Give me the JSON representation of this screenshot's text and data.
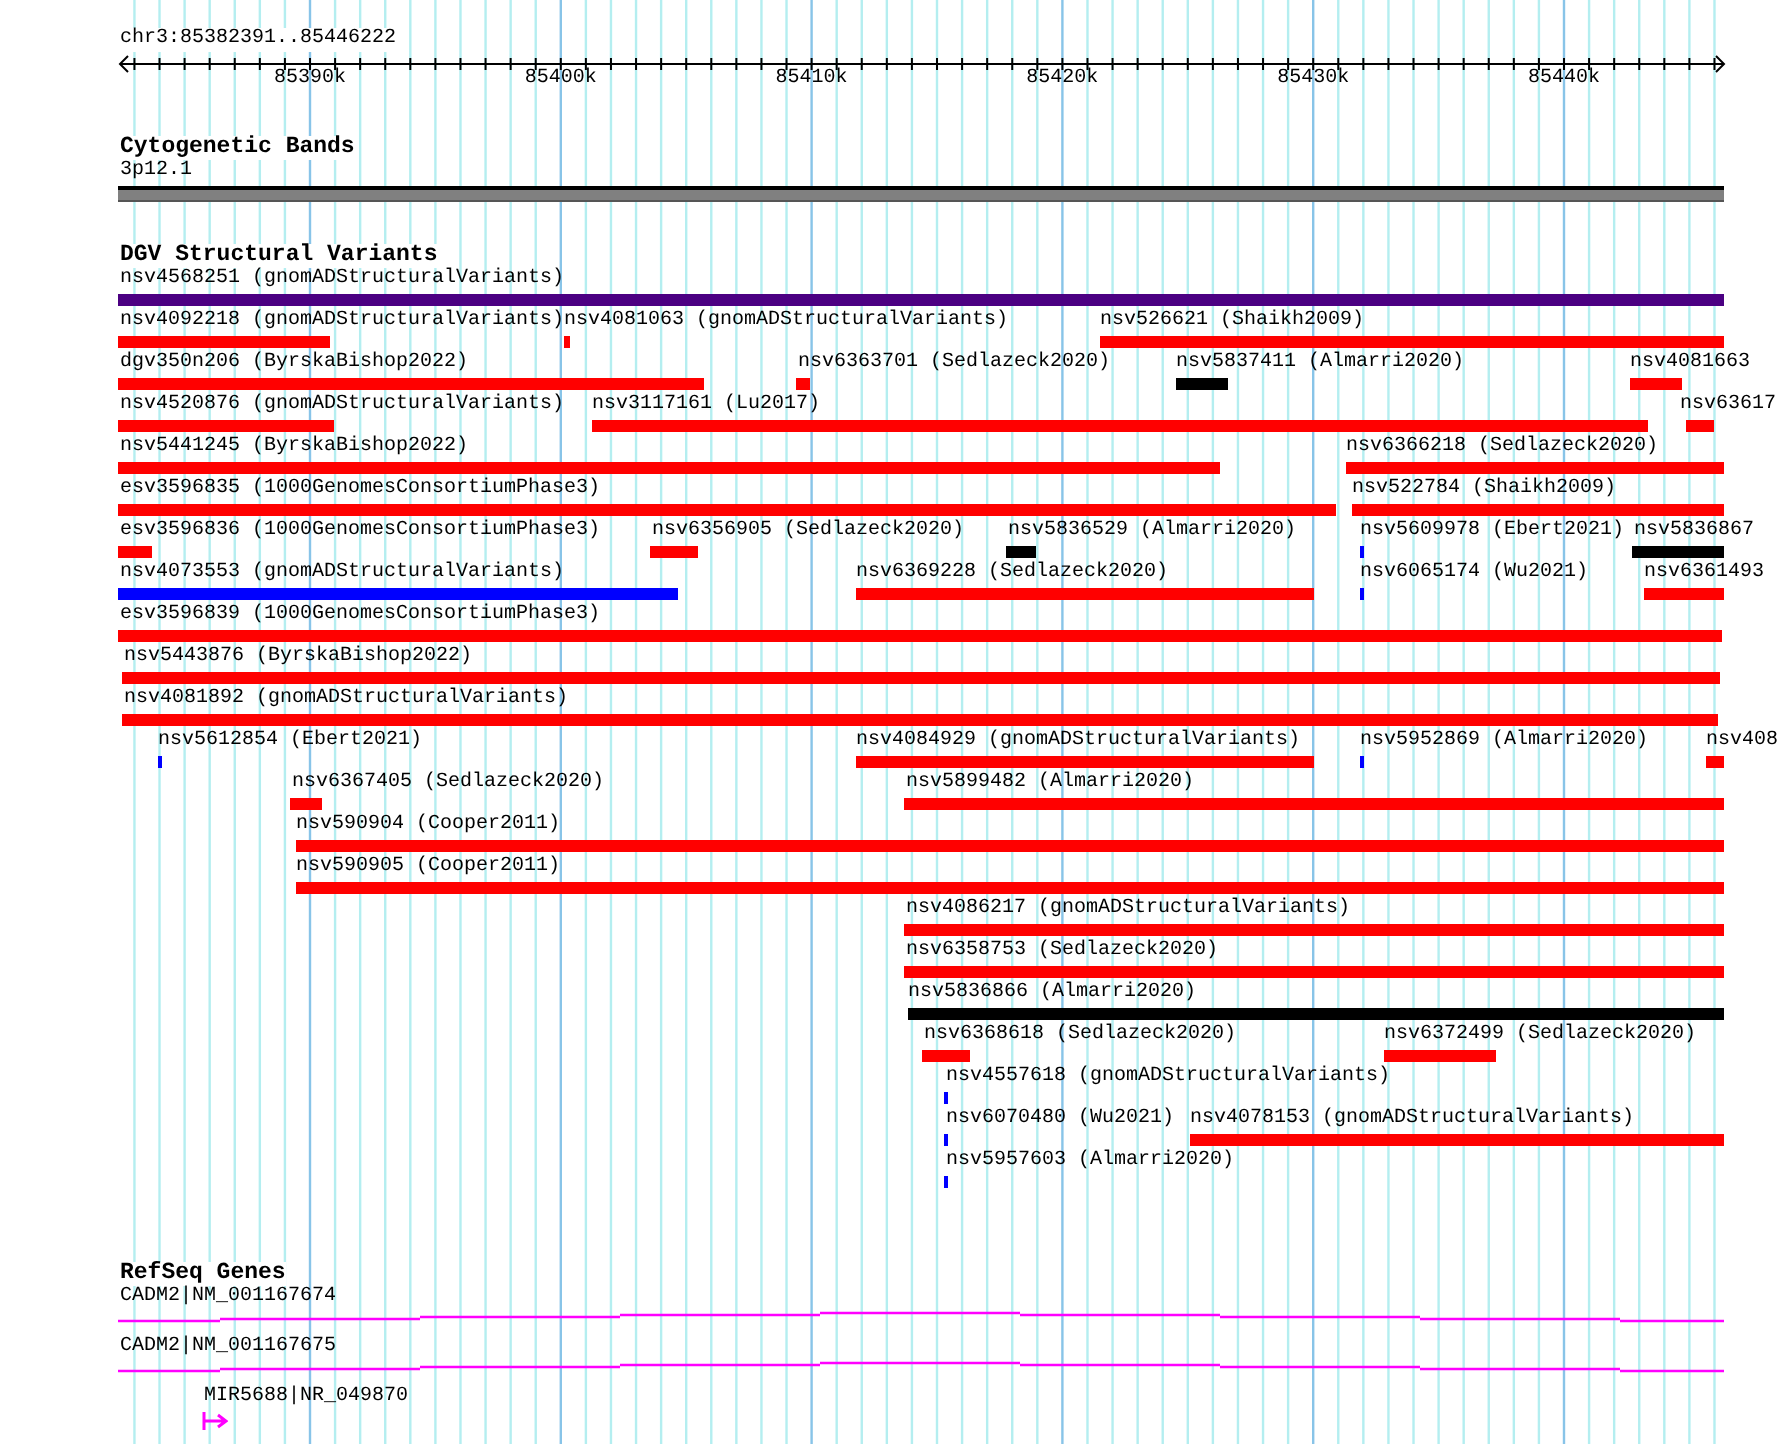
{
  "ruler": {
    "location": "chr3:85382391..85446222",
    "ticks": [
      "85390k",
      "85400k",
      "85410k",
      "85420k",
      "85430k",
      "85440k"
    ]
  },
  "tracks": [
    {
      "kind": "cytoband",
      "title": "Cytogenetic Bands",
      "band": "3p12.1"
    },
    {
      "kind": "variants",
      "title": "DGV Structural Variants",
      "rows": [
        {
          "features": [
            {
              "label": "nsv4568251 (gnomADStructuralVariants)",
              "color": "#4b0082"
            }
          ]
        },
        {
          "features": [
            {
              "label": "nsv4092218 (gnomADStructuralVariants)",
              "color": "#ff0000"
            },
            {
              "label": "nsv4081063 (gnomADStructuralVariants)",
              "color": "#ff0000"
            },
            {
              "label": "nsv526621 (Shaikh2009)",
              "color": "#ff0000"
            }
          ]
        },
        {
          "features": [
            {
              "label": "dgv350n206 (ByrskaBishop2022)",
              "color": "#ff0000"
            },
            {
              "label": "nsv6363701 (Sedlazeck2020)",
              "color": "#ff0000"
            },
            {
              "label": "nsv5837411 (Almarri2020)",
              "color": "#000000"
            },
            {
              "label": "nsv4081663",
              "color": "#ff0000"
            }
          ]
        },
        {
          "features": [
            {
              "label": "nsv4520876 (gnomADStructuralVariants)",
              "color": "#ff0000"
            },
            {
              "label": "nsv3117161 (Lu2017)",
              "color": "#ff0000"
            },
            {
              "label": "nsv63617",
              "color": "#ff0000"
            }
          ]
        },
        {
          "features": [
            {
              "label": "nsv5441245 (ByrskaBishop2022)",
              "color": "#ff0000"
            },
            {
              "label": "nsv6366218 (Sedlazeck2020)",
              "color": "#ff0000"
            }
          ]
        },
        {
          "features": [
            {
              "label": "esv3596835 (1000GenomesConsortiumPhase3)",
              "color": "#ff0000"
            },
            {
              "label": "nsv522784 (Shaikh2009)",
              "color": "#ff0000"
            }
          ]
        },
        {
          "features": [
            {
              "label": "esv3596836 (1000GenomesConsortiumPhase3)",
              "color": "#ff0000"
            },
            {
              "label": "nsv6356905 (Sedlazeck2020)",
              "color": "#ff0000"
            },
            {
              "label": "nsv5836529 (Almarri2020)",
              "color": "#000000"
            },
            {
              "label": "nsv5609978 (Ebert2021)",
              "color": "#0000ff"
            },
            {
              "label": "nsv5836867",
              "color": "#000000"
            }
          ]
        },
        {
          "features": [
            {
              "label": "nsv4073553 (gnomADStructuralVariants)",
              "color": "#0000ff"
            },
            {
              "label": "nsv6369228 (Sedlazeck2020)",
              "color": "#ff0000"
            },
            {
              "label": "nsv6065174 (Wu2021)",
              "color": "#0000ff"
            },
            {
              "label": "nsv6361493",
              "color": "#ff0000"
            }
          ]
        },
        {
          "features": [
            {
              "label": "esv3596839 (1000GenomesConsortiumPhase3)",
              "color": "#ff0000"
            }
          ]
        },
        {
          "features": [
            {
              "label": "nsv5443876 (ByrskaBishop2022)",
              "color": "#ff0000"
            }
          ]
        },
        {
          "features": [
            {
              "label": "nsv4081892 (gnomADStructuralVariants)",
              "color": "#ff0000"
            }
          ]
        },
        {
          "features": [
            {
              "label": "nsv5612854 (Ebert2021)",
              "color": "#0000ff"
            },
            {
              "label": "nsv4084929 (gnomADStructuralVariants)",
              "color": "#ff0000"
            },
            {
              "label": "nsv5952869 (Almarri2020)",
              "color": "#0000ff"
            },
            {
              "label": "nsv408",
              "color": "#ff0000"
            }
          ]
        },
        {
          "features": [
            {
              "label": "nsv6367405 (Sedlazeck2020)",
              "color": "#ff0000"
            },
            {
              "label": "nsv5899482 (Almarri2020)",
              "color": "#ff0000"
            }
          ]
        },
        {
          "features": [
            {
              "label": "nsv590904 (Cooper2011)",
              "color": "#ff0000"
            }
          ]
        },
        {
          "features": [
            {
              "label": "nsv590905 (Cooper2011)",
              "color": "#ff0000"
            }
          ]
        },
        {
          "features": [
            {
              "label": "nsv4086217 (gnomADStructuralVariants)",
              "color": "#ff0000"
            }
          ]
        },
        {
          "features": [
            {
              "label": "nsv6358753 (Sedlazeck2020)",
              "color": "#ff0000"
            }
          ]
        },
        {
          "features": [
            {
              "label": "nsv5836866 (Almarri2020)",
              "color": "#000000"
            }
          ]
        },
        {
          "features": [
            {
              "label": "nsv6368618 (Sedlazeck2020)",
              "color": "#ff0000"
            },
            {
              "label": "nsv6372499 (Sedlazeck2020)",
              "color": "#ff0000"
            }
          ]
        },
        {
          "features": [
            {
              "label": "nsv4557618 (gnomADStructuralVariants)",
              "color": "#0000ff"
            }
          ]
        },
        {
          "features": [
            {
              "label": "nsv6070480 (Wu2021)",
              "color": "#0000ff"
            },
            {
              "label": "nsv4078153 (gnomADStructuralVariants)",
              "color": "#ff0000"
            }
          ]
        },
        {
          "features": [
            {
              "label": "nsv5957603 (Almarri2020)",
              "color": "#0000ff"
            }
          ]
        }
      ]
    },
    {
      "kind": "genes",
      "title": "RefSeq Genes",
      "genes": [
        {
          "kind": "transcript",
          "label": "CADM2|NM_001167674"
        },
        {
          "kind": "transcript",
          "label": "CADM2|NM_001167675"
        },
        {
          "kind": "marker",
          "label": "MIR5688|NR_049870"
        }
      ]
    }
  ]
}
